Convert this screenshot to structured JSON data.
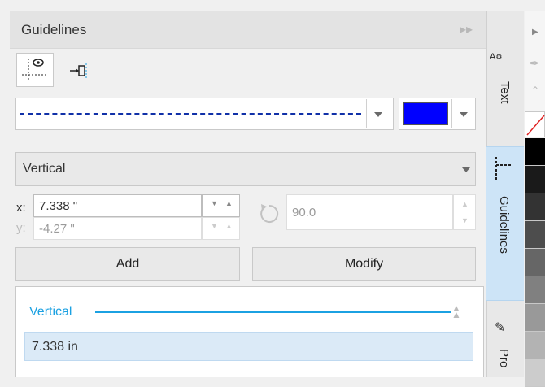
{
  "panel": {
    "title": "Guidelines",
    "line_style": "dashed",
    "line_color": "#0000ff",
    "orientation": {
      "selected": "Vertical"
    },
    "x_field": {
      "label": "x:",
      "value": "7.338 \""
    },
    "y_field": {
      "label": "y:",
      "value": "-4.27 \""
    },
    "angle_field": {
      "value": "90.0"
    },
    "add_label": "Add",
    "modify_label": "Modify",
    "list": {
      "group_label": "Vertical",
      "items": [
        "7.338 in"
      ]
    },
    "accent_color": "#1ba1e2",
    "selection_color": "#dbeaf7"
  },
  "side_tabs": {
    "text_label": "Text",
    "guidelines_label": "Guidelines",
    "properties_label": "Pro"
  },
  "palette": {
    "swatches": [
      "#000000",
      "#1a1a1a",
      "#333333",
      "#4d4d4d",
      "#666666",
      "#808080",
      "#999999",
      "#b3b3b3",
      "#cccccc"
    ]
  }
}
